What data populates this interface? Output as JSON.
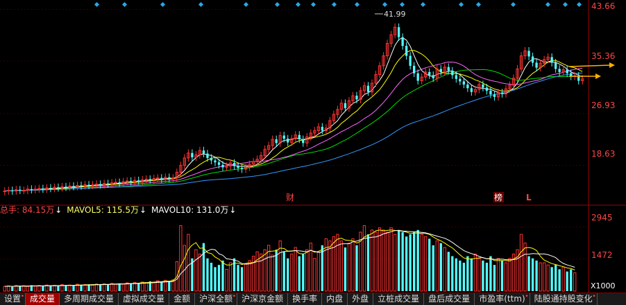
{
  "price_axis_labels": [
    "43.66",
    "35.36",
    "26.93",
    "18.63"
  ],
  "volume_axis_labels": [
    "2945",
    "1472"
  ],
  "volume_unit": "X1000",
  "peak_annotation": "41.99",
  "event_markers": [
    "财",
    "榜",
    "L"
  ],
  "volume_legend": [
    {
      "label": "总手: 84.15万",
      "arrow": "↓",
      "color": "#ff4444"
    },
    {
      "label": "MAVOL5: 115.5万",
      "arrow": "↓",
      "color": "#ffff66"
    },
    {
      "label": "MAVOL10: 131.0万",
      "arrow": "↓",
      "color": "#ffffff"
    }
  ],
  "tabs": [
    {
      "label": "设置",
      "dot": true
    },
    {
      "label": "成交量",
      "active": true
    },
    {
      "label": "多周期成交量"
    },
    {
      "label": "虚拟成交量"
    },
    {
      "label": "金额"
    },
    {
      "label": "沪深全额",
      "dot": true
    },
    {
      "label": "沪深京金额"
    },
    {
      "label": "换手率"
    },
    {
      "label": "内盘"
    },
    {
      "label": "外盘"
    },
    {
      "label": "立桩成交量"
    },
    {
      "label": "盘后成交量"
    },
    {
      "label": "市盈率(ttm)",
      "dot": true
    },
    {
      "label": "陆股通持股变化",
      "dot": true
    }
  ],
  "colors": {
    "up": "#ff3333",
    "down": "#54ffff",
    "axis": "#a00000",
    "ma5": "#ffffff",
    "ma10": "#ffff00",
    "ma20": "#ff66ff",
    "ma30": "#00dd00",
    "ma60": "#3399ff",
    "arrow": "#ffb000"
  },
  "chart_data": {
    "type": "candlestick",
    "price_range": [
      14.0,
      44.5
    ],
    "volume_range_x1000": [
      0,
      3300
    ],
    "closes": [
      14.5,
      14.6,
      14.5,
      14.7,
      14.6,
      14.6,
      14.8,
      14.7,
      14.8,
      14.9,
      14.8,
      15.0,
      14.9,
      15.1,
      15.0,
      15.2,
      15.1,
      15.3,
      15.2,
      15.4,
      15.3,
      15.5,
      15.4,
      15.5,
      15.6,
      15.5,
      15.7,
      15.6,
      15.8,
      15.9,
      15.8,
      16.0,
      16.1,
      16.0,
      16.2,
      16.1,
      16.3,
      16.4,
      16.3,
      16.5,
      16.6,
      16.4,
      16.7,
      16.5,
      16.6,
      17.5,
      18.6,
      19.8,
      20.6,
      19.9,
      20.3,
      21.0,
      20.5,
      19.8,
      19.4,
      19.1,
      18.7,
      18.3,
      18.5,
      19.0,
      18.5,
      18.2,
      18.0,
      18.3,
      18.8,
      19.2,
      19.6,
      20.2,
      21.2,
      21.8,
      22.8,
      22.2,
      23.4,
      22.9,
      22.3,
      22.9,
      23.5,
      22.8,
      22.2,
      23.2,
      23.8,
      24.2,
      24.8,
      24.2,
      24.6,
      25.8,
      26.8,
      27.6,
      28.6,
      27.8,
      29.0,
      29.8,
      29.2,
      30.6,
      31.4,
      30.4,
      31.8,
      33.2,
      34.6,
      36.2,
      38.2,
      39.6,
      40.8,
      39.2,
      37.8,
      36.2,
      34.6,
      33.4,
      32.2,
      32.8,
      33.6,
      33.1,
      32.6,
      34.1,
      33.6,
      34.4,
      33.8,
      33.1,
      32.5,
      32.1,
      31.6,
      31.0,
      30.4,
      30.8,
      31.6,
      31.1,
      30.6,
      30.0,
      29.6,
      30.3,
      30.1,
      30.9,
      31.5,
      32.6,
      34.1,
      36.2,
      37.0,
      36.1,
      35.1,
      34.3,
      35.0,
      35.6,
      36.0,
      35.1,
      34.1,
      33.6,
      34.0,
      33.4,
      32.9,
      33.0,
      32.2,
      32.5
    ],
    "opens": [
      14.4,
      14.5,
      14.6,
      14.5,
      14.7,
      14.6,
      14.6,
      14.8,
      14.7,
      14.8,
      14.9,
      14.8,
      15.0,
      14.9,
      15.1,
      15.0,
      15.2,
      15.1,
      15.3,
      15.2,
      15.4,
      15.3,
      15.5,
      15.4,
      15.5,
      15.6,
      15.5,
      15.7,
      15.6,
      15.8,
      15.9,
      15.8,
      16.0,
      16.1,
      16.0,
      16.2,
      16.1,
      16.3,
      16.4,
      16.3,
      16.5,
      16.6,
      16.4,
      16.7,
      16.5,
      16.6,
      17.5,
      18.6,
      19.8,
      20.6,
      19.9,
      20.3,
      21.0,
      20.5,
      19.8,
      19.4,
      19.1,
      18.7,
      18.3,
      18.5,
      19.0,
      18.5,
      18.2,
      18.0,
      18.3,
      18.8,
      19.2,
      19.6,
      20.2,
      21.2,
      21.8,
      22.8,
      22.2,
      23.4,
      22.9,
      22.3,
      22.9,
      23.5,
      22.8,
      22.2,
      23.2,
      23.8,
      24.2,
      24.8,
      24.2,
      24.6,
      25.8,
      26.8,
      27.6,
      28.6,
      27.8,
      29.0,
      29.8,
      29.2,
      30.6,
      31.4,
      30.4,
      31.8,
      33.2,
      34.6,
      36.2,
      38.2,
      39.6,
      40.8,
      39.2,
      37.8,
      36.2,
      34.6,
      33.4,
      32.2,
      32.8,
      33.6,
      33.1,
      32.6,
      34.1,
      33.6,
      34.4,
      33.8,
      33.1,
      32.5,
      32.1,
      31.6,
      31.0,
      30.4,
      30.8,
      31.6,
      31.1,
      30.6,
      30.0,
      29.6,
      30.3,
      30.1,
      30.9,
      31.5,
      32.6,
      34.1,
      36.2,
      37.0,
      36.1,
      35.1,
      34.3,
      35.0,
      35.6,
      36.0,
      35.1,
      34.1,
      33.6,
      34.0,
      33.4,
      32.9,
      33.0,
      32.2
    ],
    "volumes_x1000": [
      220,
      240,
      200,
      260,
      230,
      250,
      210,
      270,
      240,
      260,
      230,
      280,
      250,
      270,
      240,
      300,
      260,
      280,
      250,
      320,
      290,
      300,
      310,
      280,
      330,
      300,
      340,
      310,
      360,
      330,
      350,
      320,
      380,
      360,
      400,
      370,
      420,
      390,
      450,
      420,
      480,
      440,
      500,
      460,
      520,
      1350,
      3000,
      2100,
      2600,
      1500,
      1900,
      1700,
      2200,
      1500,
      1300,
      1100,
      1200,
      1400,
      1000,
      1300,
      1500,
      1200,
      1100,
      1250,
      1400,
      1600,
      1800,
      1700,
      1900,
      2100,
      1650,
      1900,
      2300,
      1800,
      1500,
      1700,
      2000,
      1600,
      1700,
      1900,
      2200,
      1500,
      1800,
      2100,
      2400,
      2300,
      2500,
      2600,
      2300,
      2000,
      2200,
      2400,
      2100,
      2700,
      3000,
      2600,
      2800,
      2700,
      2900,
      2800,
      2700,
      2900,
      2600,
      2800,
      2700,
      2500,
      2600,
      2700,
      2800,
      2600,
      2500,
      2400,
      2100,
      2300,
      2200,
      2000,
      1800,
      1600,
      1500,
      1400,
      1300,
      1600,
      1500,
      1700,
      1500,
      1400,
      1300,
      1600,
      1200,
      1500,
      1400,
      1300,
      1500,
      1700,
      1900,
      2600,
      2200,
      1600,
      1500,
      1400,
      1300,
      1300,
      1200,
      1100,
      1200,
      1000,
      1100,
      900,
      1000,
      840
    ]
  }
}
